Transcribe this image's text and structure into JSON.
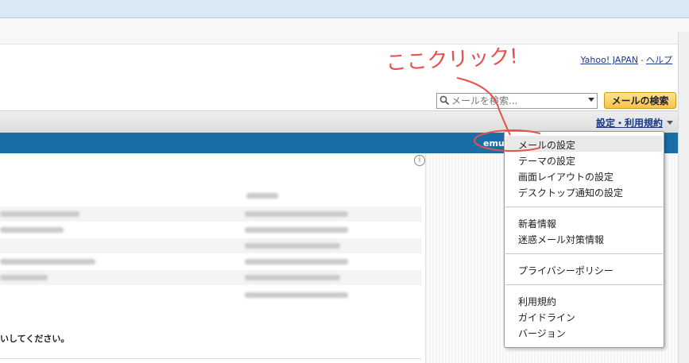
{
  "header": {
    "top_links": {
      "yahoo": "Yahoo! JAPAN",
      "separator": "-",
      "help": "ヘルプ"
    },
    "search": {
      "placeholder": "メールを検索...",
      "button_label": "メールの検索",
      "icon": "magnifier-icon"
    },
    "settings_link": "設定・利用規約"
  },
  "account_bar": {
    "user_fragment": "emu"
  },
  "annotation": {
    "text": "ここクリック!",
    "color": "#e8504a"
  },
  "notice_text": "いしてください。",
  "menu": {
    "groups": [
      {
        "items": [
          "メールの設定",
          "テーマの設定",
          "画面レイアウトの設定",
          "デスクトップ通知の設定"
        ]
      },
      {
        "items": [
          "新着情報",
          "迷惑メール対策情報"
        ]
      },
      {
        "items": [
          "プライバシーポリシー"
        ]
      },
      {
        "items": [
          "利用規約",
          "ガイドライン",
          "バージョン"
        ]
      }
    ]
  },
  "colors": {
    "blue_bar": "#1a6ea8",
    "link": "#1a3a8a",
    "button": "#f8c34a"
  }
}
